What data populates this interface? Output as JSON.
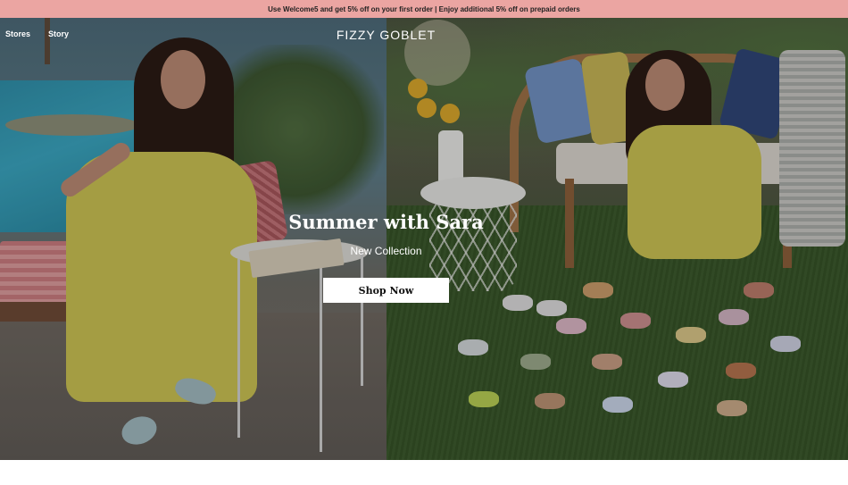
{
  "announcement": {
    "text": "Use Welcome5 and get 5% off on your first order | Enjoy additional 5% off on prepaid orders"
  },
  "header": {
    "nav": [
      {
        "label": "Stores"
      },
      {
        "label": "Story"
      }
    ],
    "brand": "FIZZY GOBLET"
  },
  "hero": {
    "title": "Summer with Sara",
    "subtitle": "New Collection",
    "cta_label": "Shop Now"
  },
  "colors": {
    "announcement_bg": "#eba5a2",
    "dress_yellow": "#c8c052",
    "button_bg": "#ffffff"
  }
}
